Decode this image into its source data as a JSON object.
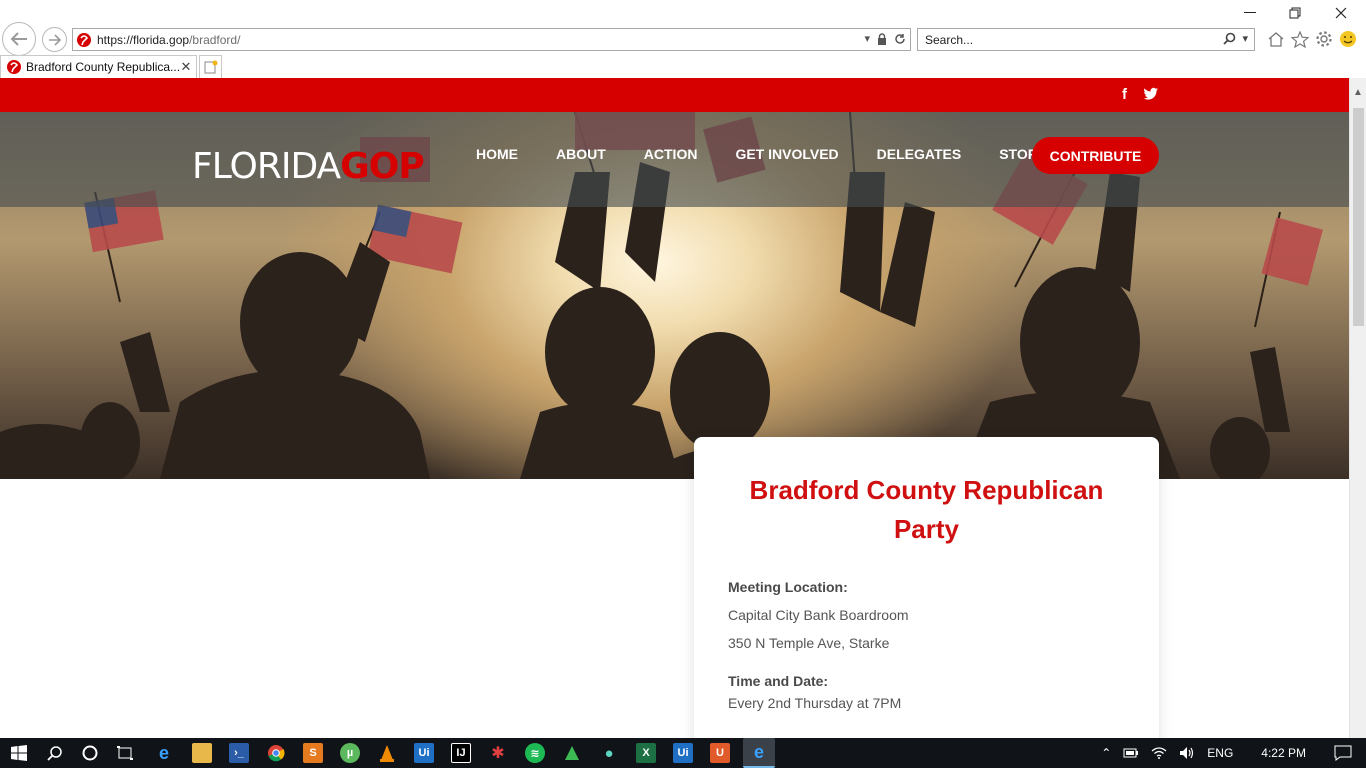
{
  "browser": {
    "address_host": "https://florida.gop",
    "address_path": "/bradford/",
    "search_placeholder": "Search...",
    "tab_title": "Bradford County Republica...",
    "tab_close": "✕"
  },
  "site": {
    "logo_main": "FLORIDA",
    "logo_accent": "GOP",
    "social": [
      "f",
      "t"
    ],
    "menu": [
      "HOME",
      "ABOUT",
      "ACTION",
      "GET INVOLVED",
      "DELEGATES",
      "STORE"
    ],
    "cta": "CONTRIBUTE"
  },
  "card": {
    "title": "Bradford County Republican Party",
    "meeting_label": "Meeting Location:",
    "meeting_line1": "Capital City Bank Boardroom",
    "meeting_line2": "350 N Temple Ave, Starke",
    "time_label": "Time and Date:",
    "time_value": "Every 2nd Thursday at 7PM"
  },
  "taskbar": {
    "language": "ENG",
    "time": "4:22 PM"
  },
  "colors": {
    "brand_red": "#d60000",
    "title_red": "#d01010"
  }
}
